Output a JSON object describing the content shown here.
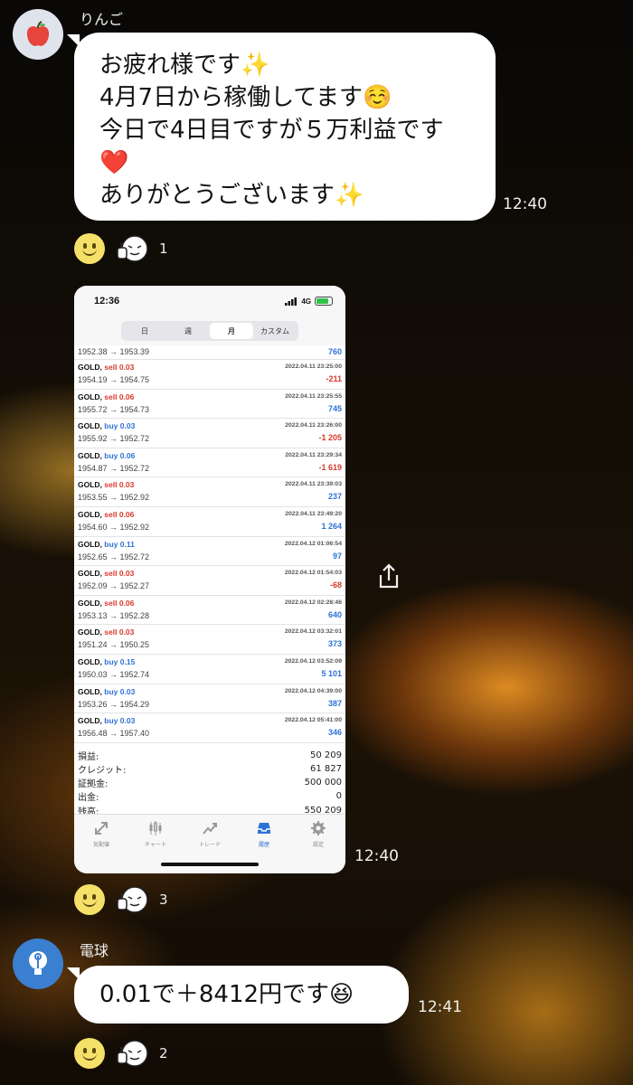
{
  "messages": [
    {
      "sender": "りんご",
      "lines": [
        "お疲れ様です✨",
        "4月7日から稼働してます☺️",
        "今日で4日目ですが５万利益です",
        "❤️",
        "ありがとうございます✨"
      ],
      "time": "12:40",
      "reaction_count": "1"
    },
    {
      "image_time": "12:40",
      "reaction_count": "3"
    },
    {
      "sender": "電球",
      "text": "0.01で＋8412円です😆",
      "time": "12:41",
      "reaction_count": "2"
    }
  ],
  "screenshot": {
    "status_time": "12:36",
    "network": "4G",
    "segments": [
      "日",
      "週",
      "月",
      "カスタム"
    ],
    "active_segment": "月",
    "partial_row": {
      "prices": "1952.38 → 1953.39",
      "pl": "760"
    },
    "trades": [
      {
        "symbol": "GOLD,",
        "side": "sell 0.03",
        "type": "sell",
        "prices": "1954.19 → 1954.75",
        "datetime": "2022.04.11 23:25:00",
        "pl": "-211"
      },
      {
        "symbol": "GOLD,",
        "side": "sell 0.06",
        "type": "sell",
        "prices": "1955.72 → 1954.73",
        "datetime": "2022.04.11 23:25:55",
        "pl": "745"
      },
      {
        "symbol": "GOLD,",
        "side": "buy 0.03",
        "type": "buy",
        "prices": "1955.92 → 1952.72",
        "datetime": "2022.04.11 23:26:00",
        "pl": "-1 205"
      },
      {
        "symbol": "GOLD,",
        "side": "buy 0.06",
        "type": "buy",
        "prices": "1954.87 → 1952.72",
        "datetime": "2022.04.11 23:29:34",
        "pl": "-1 619"
      },
      {
        "symbol": "GOLD,",
        "side": "sell 0.03",
        "type": "sell",
        "prices": "1953.55 → 1952.92",
        "datetime": "2022.04.11 23:39:03",
        "pl": "237"
      },
      {
        "symbol": "GOLD,",
        "side": "sell 0.06",
        "type": "sell",
        "prices": "1954.60 → 1952.92",
        "datetime": "2022.04.11 23:49:20",
        "pl": "1 264"
      },
      {
        "symbol": "GOLD,",
        "side": "buy 0.11",
        "type": "buy",
        "prices": "1952.65 → 1952.72",
        "datetime": "2022.04.12 01:06:54",
        "pl": "97"
      },
      {
        "symbol": "GOLD,",
        "side": "sell 0.03",
        "type": "sell",
        "prices": "1952.09 → 1952.27",
        "datetime": "2022.04.12 01:54:03",
        "pl": "-68"
      },
      {
        "symbol": "GOLD,",
        "side": "sell 0.06",
        "type": "sell",
        "prices": "1953.13 → 1952.28",
        "datetime": "2022.04.12 02:28:46",
        "pl": "640"
      },
      {
        "symbol": "GOLD,",
        "side": "sell 0.03",
        "type": "sell",
        "prices": "1951.24 → 1950.25",
        "datetime": "2022.04.12 03:32:01",
        "pl": "373"
      },
      {
        "symbol": "GOLD,",
        "side": "buy 0.15",
        "type": "buy",
        "prices": "1950.03 → 1952.74",
        "datetime": "2022.04.12 03:52:09",
        "pl": "5 101"
      },
      {
        "symbol": "GOLD,",
        "side": "buy 0.03",
        "type": "buy",
        "prices": "1953.26 → 1954.29",
        "datetime": "2022.04.12 04:39:00",
        "pl": "387"
      },
      {
        "symbol": "GOLD,",
        "side": "buy 0.03",
        "type": "buy",
        "prices": "1956.48 → 1957.40",
        "datetime": "2022.04.12 05:41:00",
        "pl": "346"
      }
    ],
    "summary": [
      {
        "label": "損益:",
        "value": "50 209"
      },
      {
        "label": "クレジット:",
        "value": "61 827"
      },
      {
        "label": "証拠金:",
        "value": "500 000"
      },
      {
        "label": "出金:",
        "value": "0"
      },
      {
        "label": "残高:",
        "value": "550 209"
      }
    ],
    "tabs": [
      {
        "label": "気配値",
        "icon": "arrows-icon"
      },
      {
        "label": "チャート",
        "icon": "candlestick-icon"
      },
      {
        "label": "トレード",
        "icon": "trend-icon"
      },
      {
        "label": "履歴",
        "icon": "inbox-icon",
        "active": true
      },
      {
        "label": "設定",
        "icon": "gear-icon"
      }
    ]
  },
  "colors": {
    "sell": "#d83a2e",
    "buy": "#2f72d6",
    "active_tab": "#2f72d6"
  }
}
